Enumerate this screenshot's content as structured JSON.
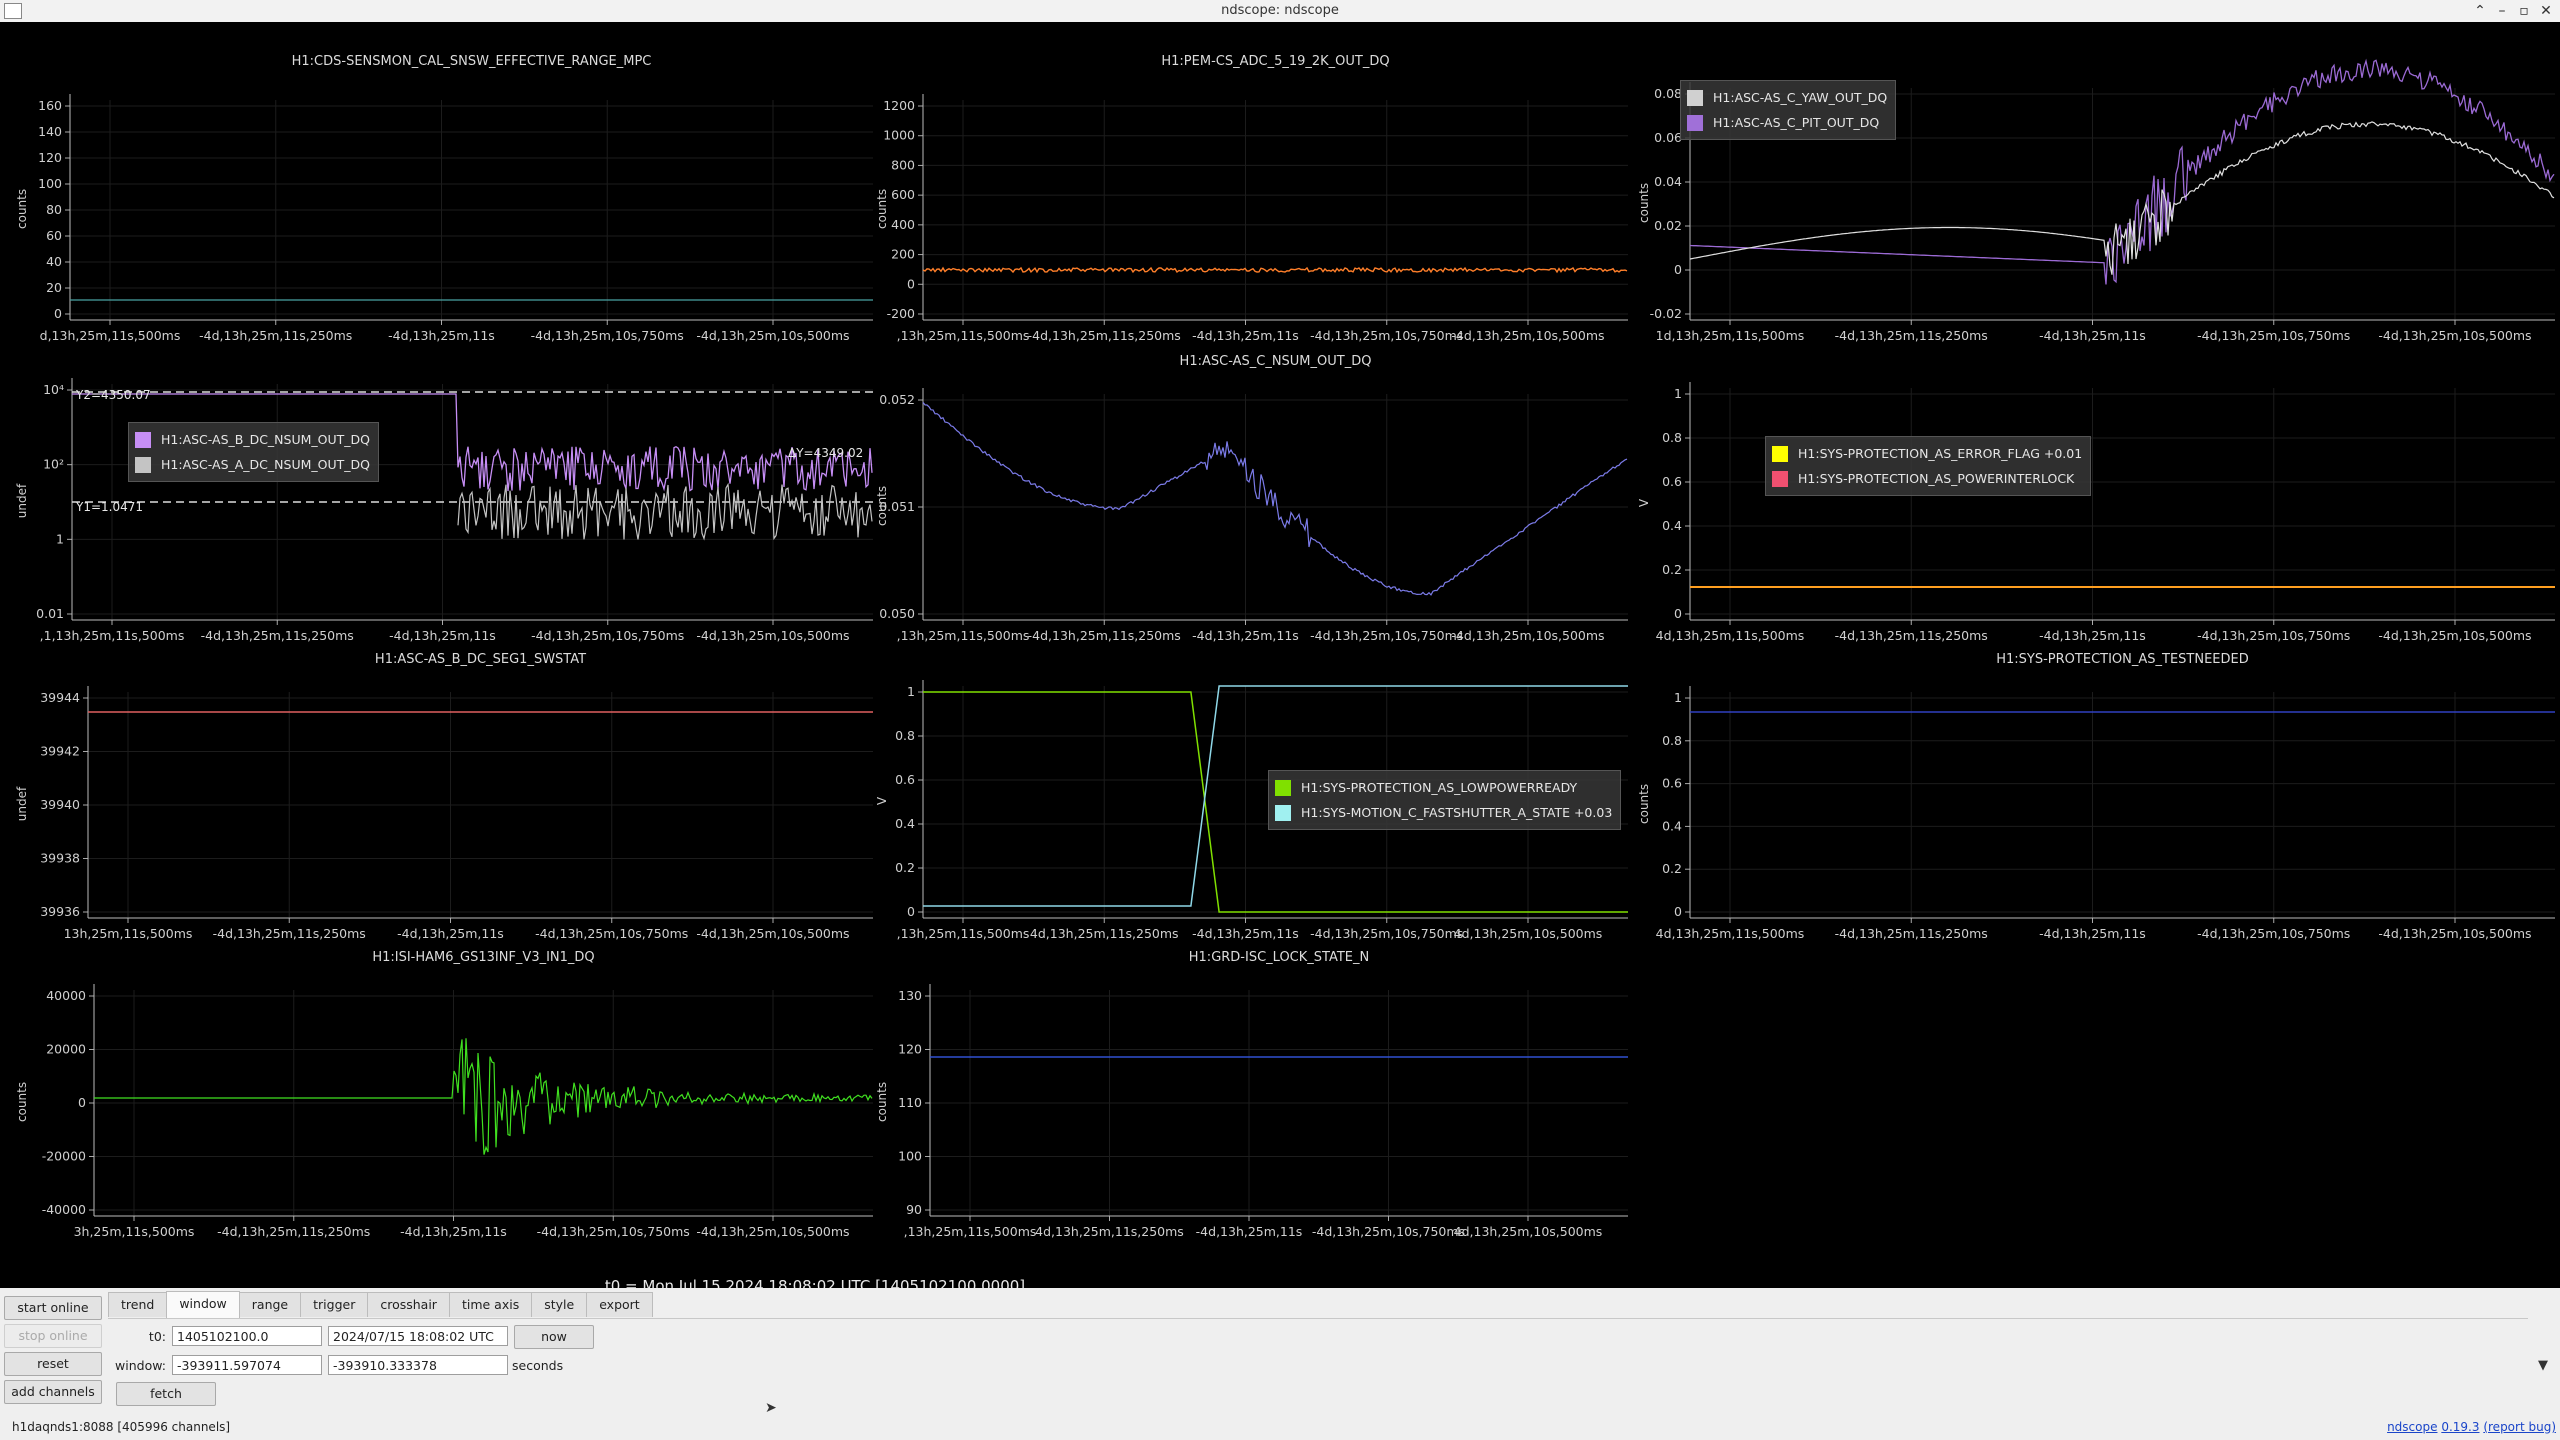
{
  "window": {
    "title": "ndscope: ndscope"
  },
  "plots": [
    {
      "id": "p1",
      "title": "H1:CDS-SENSMON_CAL_SNSW_EFFECTIVE_RANGE_MPC",
      "ylabel": "counts",
      "yticks": [
        "160",
        "140",
        "120",
        "100",
        "80",
        "60",
        "40",
        "20",
        "0"
      ],
      "xticks": [
        "d,13h,25m,11s,500ms",
        "-4d,13h,25m,11s,250ms",
        "-4d,13h,25m,11s",
        "-4d,13h,25m,10s,750ms",
        "-4d,13h,25m,10s,500ms"
      ],
      "trace_color": "#4aa3a3"
    },
    {
      "id": "p2",
      "title": "H1:PEM-CS_ADC_5_19_2K_OUT_DQ",
      "ylabel": "counts",
      "yticks": [
        "1200",
        "1000",
        "800",
        "600",
        "400",
        "200",
        "0",
        "-200"
      ],
      "xticks": [
        ",13h,25m,11s,500ms",
        "-4d,13h,25m,11s,250ms",
        "-4d,13h,25m,11s",
        "-4d,13h,25m,10s,750ms",
        "-4d,13h,25m,10s,500ms"
      ],
      "trace_color": "#ff7f2a"
    },
    {
      "id": "p3",
      "title": "",
      "ylabel": "counts",
      "yticks": [
        "0.08",
        "0.06",
        "0.04",
        "0.02",
        "0",
        "-0.02"
      ],
      "xticks": [
        "1d,13h,25m,11s,500ms",
        "-4d,13h,25m,11s,250ms",
        "-4d,13h,25m,11s",
        "-4d,13h,25m,10s,750ms",
        "-4d,13h,25m,10s,500ms"
      ],
      "legend": [
        {
          "label": "H1:ASC-AS_C_YAW_OUT_DQ",
          "color": "#d0d0d0"
        },
        {
          "label": "H1:ASC-AS_C_PIT_OUT_DQ",
          "color": "#a070d8"
        }
      ]
    },
    {
      "id": "p4",
      "title": "",
      "ylabel": "undef",
      "yticks": [
        "10⁴",
        "10²",
        "1",
        "0.01"
      ],
      "xticks": [
        ",1,13h,25m,11s,500ms",
        "-4d,13h,25m,11s,250ms",
        "-4d,13h,25m,11s",
        "-4d,13h,25m,10s,750ms",
        "-4d,13h,25m,10s,500ms"
      ],
      "legend": [
        {
          "label": "H1:ASC-AS_B_DC_NSUM_OUT_DQ",
          "color": "#c68ef5"
        },
        {
          "label": "H1:ASC-AS_A_DC_NSUM_OUT_DQ",
          "color": "#c4c4c4"
        }
      ],
      "cursor_y2": "Y2=4350.07",
      "cursor_y1": "Y1=1.0471",
      "cursor_dy": "ΔY=4349.02"
    },
    {
      "id": "p5",
      "title": "H1:ASC-AS_C_NSUM_OUT_DQ",
      "ylabel": "counts",
      "yticks": [
        "0.052",
        "0.051",
        "0.050"
      ],
      "xticks": [
        ",13h,25m,11s,500ms",
        "-4d,13h,25m,11s,250ms",
        "-4d,13h,25m,11s",
        "-4d,13h,25m,10s,750ms",
        "-4d,13h,25m,10s,500ms"
      ],
      "trace_color": "#7b7be8"
    },
    {
      "id": "p6",
      "title": "",
      "ylabel": "V",
      "yticks": [
        "1",
        "0.8",
        "0.6",
        "0.4",
        "0.2",
        "0"
      ],
      "xticks": [
        "4d,13h,25m,11s,500ms",
        "-4d,13h,25m,11s,250ms",
        "-4d,13h,25m,11s",
        "-4d,13h,25m,10s,750ms",
        "-4d,13h,25m,10s,500ms"
      ],
      "legend": [
        {
          "label": "H1:SYS-PROTECTION_AS_ERROR_FLAG +0.01",
          "color": "#ffff00"
        },
        {
          "label": "H1:SYS-PROTECTION_AS_POWERINTERLOCK",
          "color": "#f05070"
        }
      ]
    },
    {
      "id": "p7",
      "title": "H1:ASC-AS_B_DC_SEG1_SWSTAT",
      "ylabel": "undef",
      "yticks": [
        "39944",
        "39942",
        "39940",
        "39938",
        "39936"
      ],
      "xticks": [
        "13h,25m,11s,500ms",
        "-4d,13h,25m,11s,250ms",
        "-4d,13h,25m,11s",
        "-4d,13h,25m,10s,750ms",
        "-4d,13h,25m,10s,500ms"
      ],
      "trace_color": "#e06060"
    },
    {
      "id": "p8",
      "title": "",
      "ylabel": "V",
      "yticks": [
        "1",
        "0.8",
        "0.6",
        "0.4",
        "0.2",
        "0"
      ],
      "xticks": [
        ",13h,25m,11s,500ms",
        "4d,13h,25m,11s,250ms",
        "-4d,13h,25m,11s",
        "-4d,13h,25m,10s,750ms",
        "4d,13h,25m,10s,500ms"
      ],
      "legend": [
        {
          "label": "H1:SYS-PROTECTION_AS_LOWPOWERREADY",
          "color": "#80e000"
        },
        {
          "label": "H1:SYS-MOTION_C_FASTSHUTTER_A_STATE +0.03",
          "color": "#a0f0f0"
        }
      ]
    },
    {
      "id": "p9",
      "title": "H1:SYS-PROTECTION_AS_TESTNEEDED",
      "ylabel": "counts",
      "yticks": [
        "1",
        "0.8",
        "0.6",
        "0.4",
        "0.2",
        "0"
      ],
      "xticks": [
        "4d,13h,25m,11s,500ms",
        "-4d,13h,25m,11s,250ms",
        "-4d,13h,25m,11s",
        "-4d,13h,25m,10s,750ms",
        "-4d,13h,25m,10s,500ms"
      ],
      "trace_color": "#3040c0"
    },
    {
      "id": "p10",
      "title": "H1:ISI-HAM6_GS13INF_V3_IN1_DQ",
      "ylabel": "counts",
      "yticks": [
        "40000",
        "20000",
        "0",
        "-20000",
        "-40000"
      ],
      "xticks": [
        "3h,25m,11s,500ms",
        "-4d,13h,25m,11s,250ms",
        "-4d,13h,25m,11s",
        "-4d,13h,25m,10s,750ms",
        "-4d,13h,25m,10s,500ms"
      ],
      "trace_color": "#40e020"
    },
    {
      "id": "p11",
      "title": "H1:GRD-ISC_LOCK_STATE_N",
      "ylabel": "counts",
      "yticks": [
        "130",
        "120",
        "110",
        "100",
        "90"
      ],
      "xticks": [
        ",13h,25m,11s,500ms",
        "4d,13h,25m,11s,250ms",
        "-4d,13h,25m,11s",
        "-4d,13h,25m,10s,750ms",
        "4d,13h,25m,10s,500ms"
      ],
      "trace_color": "#3050d0"
    }
  ],
  "t0_label": "t0 = Mon Jul 15 2024 18:08:02 UTC [1405102100.0000]",
  "controls": {
    "start_online": "start online",
    "stop_online": "stop online",
    "reset": "reset",
    "add_channels": "add channels",
    "tabs": [
      "trend",
      "window",
      "range",
      "trigger",
      "crosshair",
      "time axis",
      "style",
      "export"
    ],
    "active_tab": "window",
    "t0_label": "t0:",
    "t0_gps": "1405102100.0",
    "t0_utc": "2024/07/15 18:08:02 UTC",
    "now": "now",
    "window_label": "window:",
    "window_start": "-393911.597074",
    "window_end": "-393910.333378",
    "seconds": "seconds",
    "fetch": "fetch"
  },
  "status": {
    "server": "h1daqnds1:8088",
    "channels": "[405996 channels]",
    "app": "ndscope",
    "version": "0.19.3",
    "report": "(report bug)"
  }
}
